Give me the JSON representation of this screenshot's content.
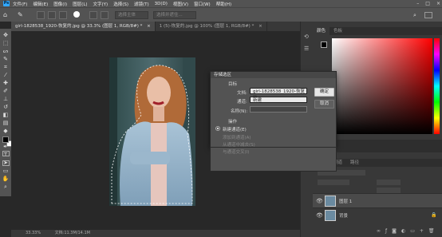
{
  "menubar": {
    "items": [
      "文件(F)",
      "编辑(E)",
      "图像(I)",
      "图层(L)",
      "文字(Y)",
      "选择(S)",
      "滤镜(T)",
      "3D(D)",
      "视图(V)",
      "窗口(W)",
      "帮助(H)"
    ]
  },
  "options": {
    "feather_field": "选择主体",
    "refine_button": "选择并遮住..."
  },
  "tabs": [
    {
      "label": "girl-1828538_1920-恢复的.jpg @ 33.3% (图层 1, RGB/8#) *",
      "close": "×"
    },
    {
      "label": "1 (5)-恢复的.jpg @ 100% (图层 1, RGB/8#) *",
      "close": "×"
    }
  ],
  "status": {
    "zoom": "33.33%",
    "doc": "文档:11.3M/14.1M"
  },
  "panels": {
    "color_tabs": [
      "颜色",
      "色板"
    ],
    "layers_tabs": [
      "图层",
      "通道",
      "路径"
    ],
    "layers": [
      {
        "name": "图层 1"
      },
      {
        "name": "背景"
      }
    ]
  },
  "dialog": {
    "title": "存储选区",
    "target_heading": "目标",
    "doc_label": "文档:",
    "doc_value": "girl-1828538_1920-恢复的.jpg",
    "channel_label": "通道:",
    "channel_value": "新建",
    "name_label": "名称(N):",
    "name_value": "",
    "ok_label": "确定",
    "cancel_label": "取消",
    "operation_heading": "操作",
    "ops": [
      {
        "label": "新建通道(E)",
        "selected": true
      },
      {
        "label": "添加到通道(A)",
        "selected": false
      },
      {
        "label": "从通道中减去(S)",
        "selected": false
      },
      {
        "label": "与通道交叉(I)",
        "selected": false
      }
    ]
  },
  "colors": {
    "accent": "#31a8ff",
    "foreground": "#000000",
    "background": "#ffffff"
  }
}
